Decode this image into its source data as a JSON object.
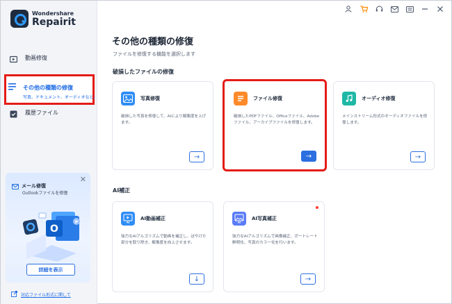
{
  "app": {
    "brand": "Wondershare",
    "name": "Repairit"
  },
  "sidebar": {
    "items": [
      {
        "label": "動画修復",
        "icon": "video-icon"
      },
      {
        "label": "その他の種類の修復",
        "sub": "写真、ドキュメント、オーディオなど。",
        "icon": "list-icon"
      },
      {
        "label": "履歴ファイル",
        "icon": "history-icon"
      }
    ]
  },
  "promo": {
    "title": "メール修復",
    "desc": "Outlookファイルを修復",
    "button": "詳細を表示"
  },
  "bottom_link": "対応ファイル形式に関して",
  "topbar": {
    "icons": [
      "user-icon",
      "cart-icon",
      "headset-icon",
      "mail-icon",
      "menu-icon",
      "minimize-icon",
      "close-icon"
    ]
  },
  "main": {
    "title": "その他の種類の修復",
    "subtitle": "ファイルを修復する機能を選択します",
    "section1": "破損したファイルの修復",
    "section2": "AI補正",
    "cards": [
      {
        "title": "写真修復",
        "desc": "破損した写真を修復して、AIにより解像度を上げます。",
        "color": "#2f8df5"
      },
      {
        "title": "ファイル修復",
        "desc": "破損したPDFファイル、Officeファイル、Adobeファイル、アーカイブファイルを修復します。",
        "color": "#ff8a2a"
      },
      {
        "title": "オーディオ修復",
        "desc": "メインストリーム形式のオーディオファイルを修復します。",
        "color": "#1fb8a6"
      },
      {
        "title": "AI動画補正",
        "desc": "強力なAIアルゴリズムで動画を補正し、ぼやけた部分を取り除き、解像度を向上させます。",
        "color": "#2f8df5"
      },
      {
        "title": "AI写真補正",
        "desc": "強力なAIアルゴリズムで画像補正、ポートレート鮮明化、写真のカラー化を行います。",
        "color": "#5b7cf7"
      }
    ]
  }
}
